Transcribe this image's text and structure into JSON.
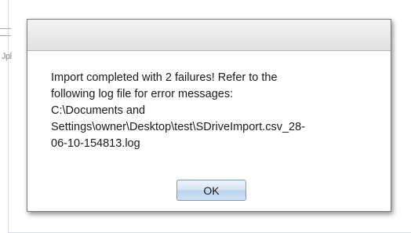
{
  "background": {
    "fragment_text": "Jpl"
  },
  "dialog": {
    "title": "",
    "message_lines": [
      "Import completed with 2 failures! Refer to the",
      "following log file for error messages:",
      "C:\\Documents and",
      "Settings\\owner\\Desktop\\test\\SDriveImport.csv_28-",
      "06-10-154813.log"
    ],
    "ok_label": "OK"
  },
  "colors": {
    "titlebar": "#e8e8e8",
    "button_accent": "#c7dbf0",
    "button_border": "#7f9db9"
  }
}
